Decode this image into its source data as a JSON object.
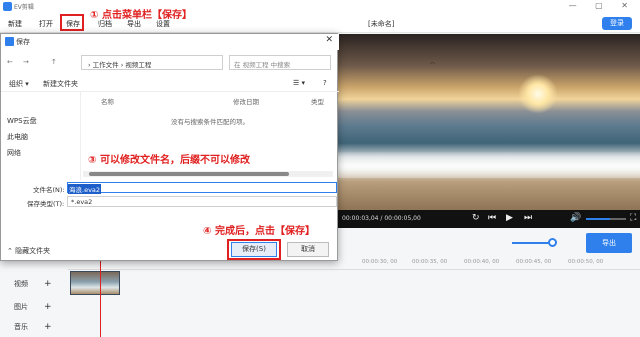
{
  "app": {
    "name": "EV剪辑",
    "project": "[未命名]",
    "login": "登录"
  },
  "window_controls": "— ▢ ✕",
  "menu": [
    "新建",
    "打开",
    "保存",
    "归档",
    "导出",
    "设置"
  ],
  "annotations": {
    "step1": "① 点击菜单栏【保存】",
    "step3": "③ 可以修改文件名，后缀不可以修改",
    "step4": "④ 完成后，点击【保存】"
  },
  "player": {
    "time": "00:00:03,04 / 00:00:05,00",
    "export": "导出",
    "volume_fraction": 0.6
  },
  "timeline": {
    "ticks": [
      "00:00:30, 00",
      "00:00:35, 00",
      "00:00:40, 00",
      "00:00:45, 00",
      "00:00:50, 00"
    ],
    "tracks": [
      "视频",
      "图片",
      "音乐"
    ]
  },
  "dialog": {
    "title": "保存",
    "close": "✕",
    "nav": {
      "back": "←",
      "forward": "→",
      "up": "↑"
    },
    "breadcrumb": "›  工作文件  ›  视频工程",
    "search_placeholder": "在 视频工程 中搜索",
    "toolbar": {
      "organize": "组织 ▾",
      "new_folder": "新建文件夹",
      "view": "☰ ▾",
      "help": "?"
    },
    "sidebar": [
      "WPS云盘",
      "此电脑",
      "网络"
    ],
    "columns": [
      "名称",
      "修改日期",
      "类型"
    ],
    "empty_message": "没有与搜索条件匹配的项。",
    "filename_label": "文件名(N):",
    "filename_value": "海浪.eva2",
    "filetype_label": "保存类型(T):",
    "filetype_value": "*.eva2",
    "hide_folders": "⌃ 隐藏文件夹",
    "save": "保存(S)",
    "cancel": "取消"
  }
}
